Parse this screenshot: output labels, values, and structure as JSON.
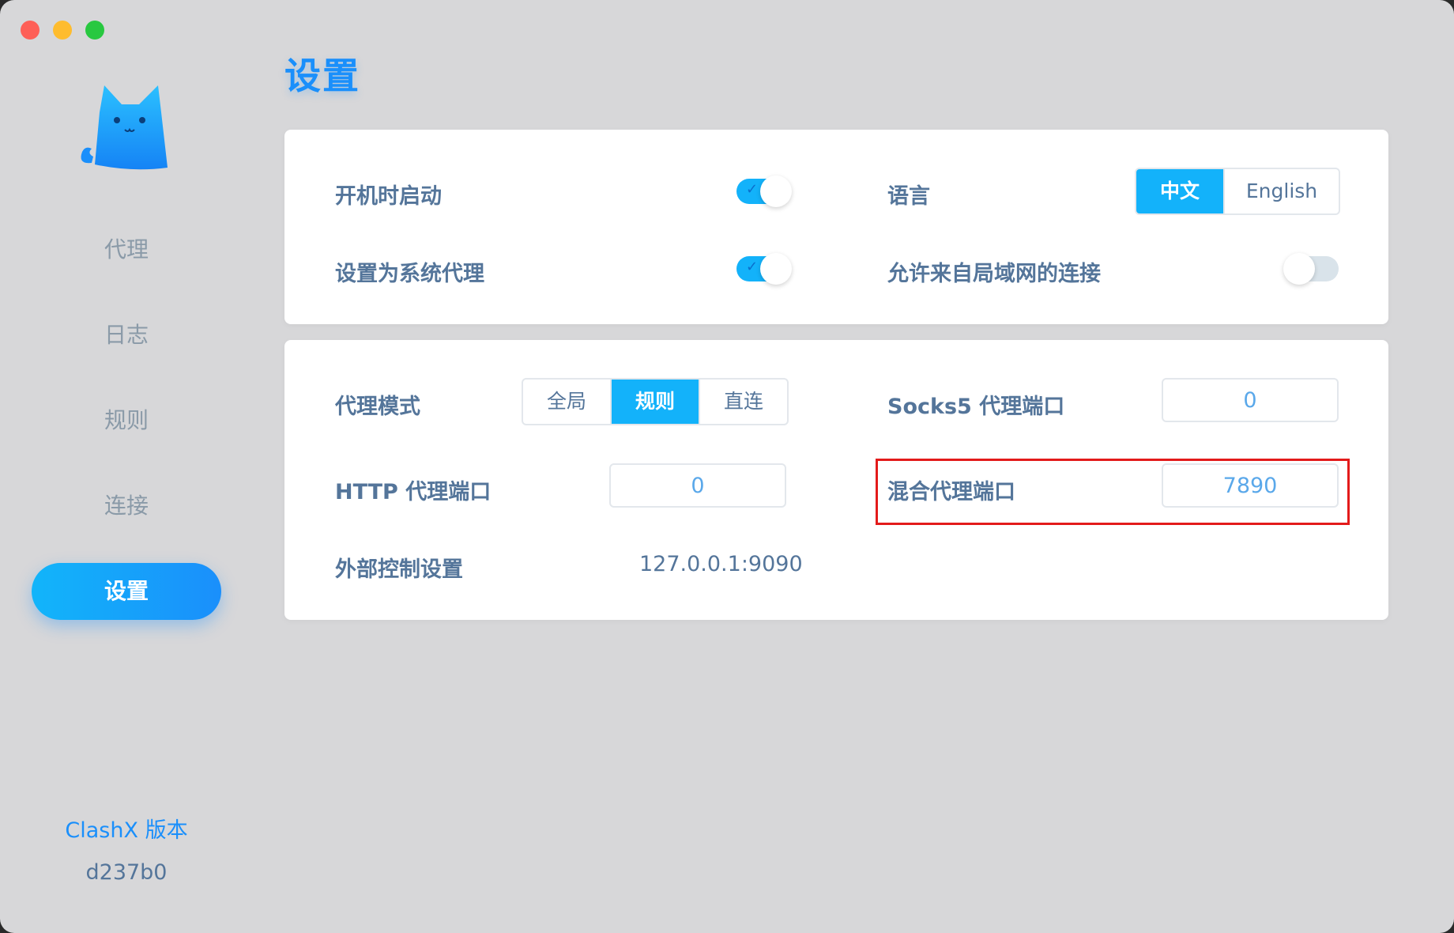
{
  "page": {
    "title": "设置"
  },
  "sidebar": {
    "items": [
      {
        "label": "代理",
        "active": false
      },
      {
        "label": "日志",
        "active": false
      },
      {
        "label": "规则",
        "active": false
      },
      {
        "label": "连接",
        "active": false
      },
      {
        "label": "设置",
        "active": true
      }
    ],
    "version_label": "ClashX 版本",
    "version_value": "d237b0"
  },
  "general": {
    "start_at_login": {
      "label": "开机时启动",
      "enabled": true
    },
    "system_proxy": {
      "label": "设置为系统代理",
      "enabled": true
    },
    "language": {
      "label": "语言",
      "options": [
        "中文",
        "English"
      ],
      "selected": "中文"
    },
    "allow_lan": {
      "label": "允许来自局域网的连接",
      "enabled": false
    }
  },
  "proxy": {
    "mode": {
      "label": "代理模式",
      "options": [
        "全局",
        "规则",
        "直连"
      ],
      "selected": "规则"
    },
    "socks5_port": {
      "label": "Socks5 代理端口",
      "value": "0"
    },
    "http_port": {
      "label": "HTTP 代理端口",
      "value": "0"
    },
    "mixed_port": {
      "label": "混合代理端口",
      "value": "7890"
    },
    "external_controller": {
      "label": "外部控制设置",
      "value": "127.0.0.1:9090"
    }
  },
  "colors": {
    "accent": "#13b2fa",
    "accent_dark": "#1a8ffb",
    "label": "#54759a",
    "highlight": "#e31b1b"
  }
}
